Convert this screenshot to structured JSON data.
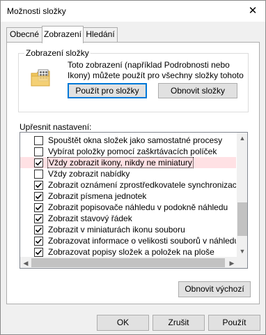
{
  "window": {
    "title": "Možnosti složky",
    "close_glyph": "✕"
  },
  "tabs": [
    {
      "label": "Obecné"
    },
    {
      "label": "Zobrazení"
    },
    {
      "label": "Hledání"
    }
  ],
  "folder_views": {
    "legend": "Zobrazení složky",
    "description": "Toto zobrazení (například Podrobnosti nebo Ikony) můžete použít pro všechny složky tohoto typu.",
    "apply_button": "Použít pro složky",
    "reset_button": "Obnovit složky"
  },
  "advanced": {
    "label": "Upřesnit nastavení:",
    "items": [
      {
        "label": "Spouštět okna složek jako samostatné procesy",
        "checked": false
      },
      {
        "label": "Vybírat položky pomocí zaškrtávacích políček",
        "checked": false
      },
      {
        "label": "Vždy zobrazit ikony, nikdy ne miniatury",
        "checked": true
      },
      {
        "label": "Vždy zobrazit nabídky",
        "checked": false
      },
      {
        "label": "Zobrazit oznámení zprostředkovatele synchronizace",
        "checked": true
      },
      {
        "label": "Zobrazit písmena jednotek",
        "checked": true
      },
      {
        "label": "Zobrazit popisovače náhledu v podokně náhledu",
        "checked": true
      },
      {
        "label": "Zobrazit stavový řádek",
        "checked": true
      },
      {
        "label": "Zobrazit v miniaturách ikonu souboru",
        "checked": true
      },
      {
        "label": "Zobrazovat informace o velikosti souborů v náhledu složk",
        "checked": true
      },
      {
        "label": "Zobrazovat popisy složek a položek na ploše",
        "checked": true
      }
    ],
    "restore_defaults_button": "Obnovit výchozí"
  },
  "footer": {
    "ok_button": "OK",
    "cancel_button": "Zrušit",
    "apply_button": "Použít"
  }
}
